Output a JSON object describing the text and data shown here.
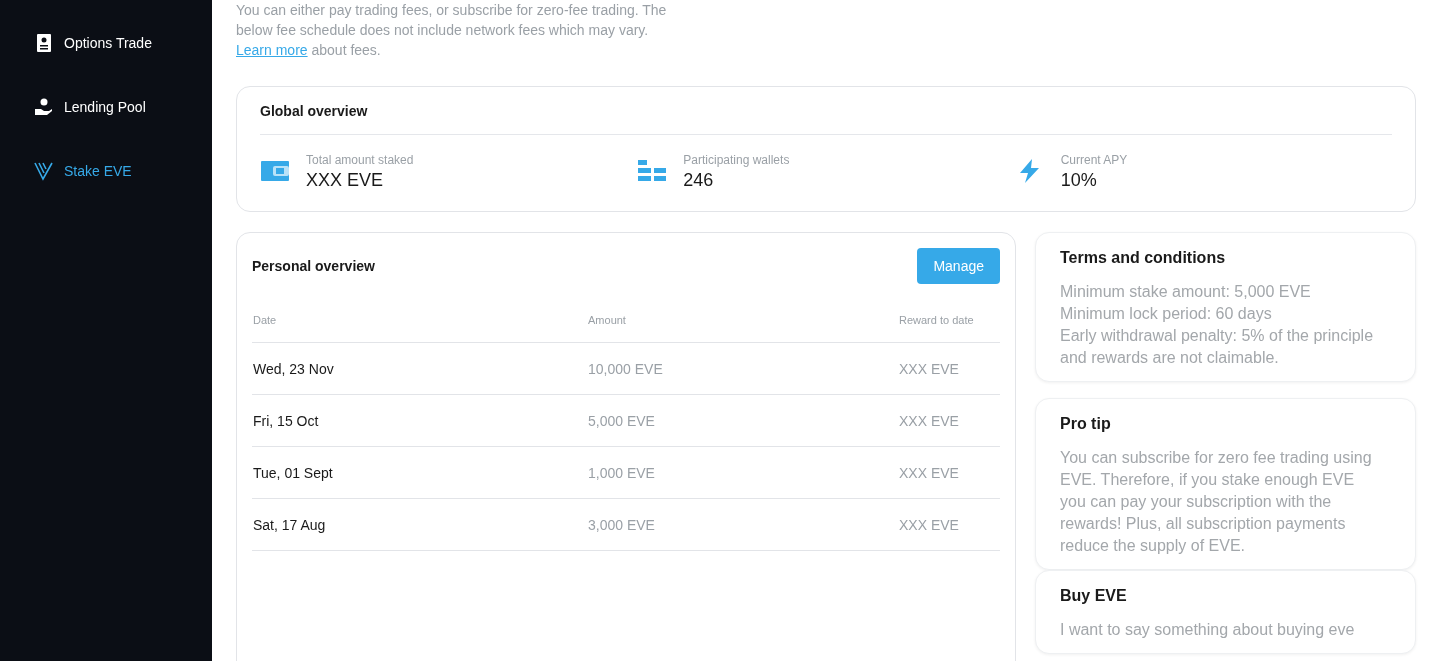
{
  "sidebar": {
    "items": [
      {
        "label": "Options Trade",
        "selected": false
      },
      {
        "label": "Lending Pool",
        "selected": false
      },
      {
        "label": "Stake EVE",
        "selected": true
      }
    ]
  },
  "intro": {
    "lines": [
      "You can either pay trading fees, or subscribe for zero-fee trading. The",
      "below fee schedule does not include network fees which may vary."
    ],
    "link": "Learn more",
    "link_suffix": " about fees."
  },
  "global_overview": {
    "title": "Global overview",
    "stats": [
      {
        "label": "Total amount staked",
        "value": "XXX EVE"
      },
      {
        "label": "Participating wallets",
        "value": "246"
      },
      {
        "label": "Current APY",
        "value": "10%"
      }
    ]
  },
  "personal_overview": {
    "title": "Personal overview",
    "button": "Manage",
    "columns": [
      "Date",
      "Amount",
      "Reward to date"
    ],
    "rows": [
      [
        "Wed, 23 Nov",
        "10,000 EVE",
        "XXX EVE"
      ],
      [
        "Fri, 15 Oct",
        "5,000 EVE",
        "XXX EVE"
      ],
      [
        "Tue, 01 Sept",
        "1,000 EVE",
        "XXX EVE"
      ],
      [
        "Sat, 17 Aug",
        "3,000 EVE",
        "XXX EVE"
      ]
    ]
  },
  "info_cards": [
    {
      "title": "Terms and conditions",
      "lines": [
        "Minimum stake amount: 5,000 EVE",
        "Minimum lock period: 60 days",
        "Early withdrawal penalty: 5% of the principle and rewards are not claimable."
      ]
    },
    {
      "title": "Pro tip",
      "lines": [
        "You can subscribe for zero fee trading using EVE. Therefore, if you stake enough EVE you can pay your subscription with the rewards! Plus, all subscription payments reduce the supply of EVE."
      ]
    },
    {
      "title": "Buy EVE",
      "lines": [
        "I want to say something about buying eve"
      ]
    }
  ]
}
